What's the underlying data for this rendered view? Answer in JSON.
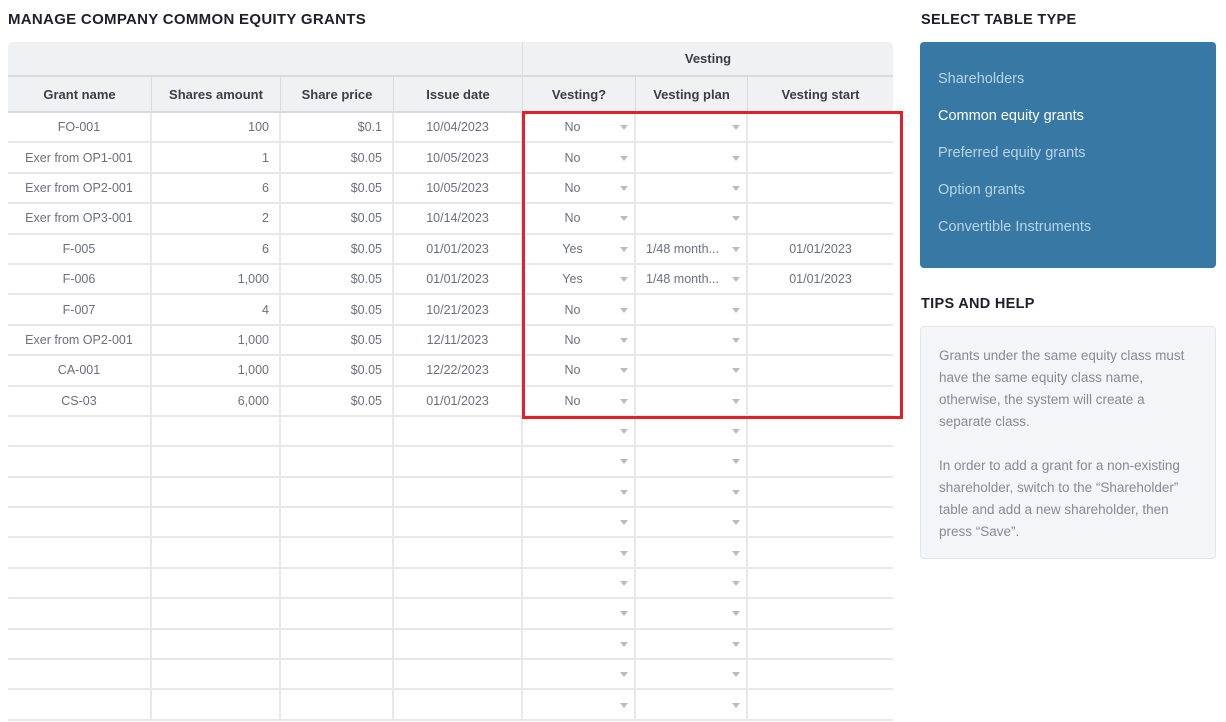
{
  "main": {
    "title": "MANAGE COMPANY COMMON EQUITY GRANTS",
    "group_header": "Vesting",
    "columns": [
      "Grant name",
      "Shares amount",
      "Share price",
      "Issue date",
      "Vesting?",
      "Vesting plan",
      "Vesting start"
    ],
    "rows": [
      {
        "grant_name": "FO-001",
        "shares": "100",
        "price": "$0.1",
        "issue_date": "10/04/2023",
        "vesting": "No",
        "plan": "",
        "start": ""
      },
      {
        "grant_name": "Exer from OP1-001",
        "shares": "1",
        "price": "$0.05",
        "issue_date": "10/05/2023",
        "vesting": "No",
        "plan": "",
        "start": ""
      },
      {
        "grant_name": "Exer from OP2-001",
        "shares": "6",
        "price": "$0.05",
        "issue_date": "10/05/2023",
        "vesting": "No",
        "plan": "",
        "start": ""
      },
      {
        "grant_name": "Exer from OP3-001",
        "shares": "2",
        "price": "$0.05",
        "issue_date": "10/14/2023",
        "vesting": "No",
        "plan": "",
        "start": ""
      },
      {
        "grant_name": "F-005",
        "shares": "6",
        "price": "$0.05",
        "issue_date": "01/01/2023",
        "vesting": "Yes",
        "plan": "1/48 month...",
        "start": "01/01/2023"
      },
      {
        "grant_name": "F-006",
        "shares": "1,000",
        "price": "$0.05",
        "issue_date": "01/01/2023",
        "vesting": "Yes",
        "plan": "1/48 month...",
        "start": "01/01/2023"
      },
      {
        "grant_name": "F-007",
        "shares": "4",
        "price": "$0.05",
        "issue_date": "10/21/2023",
        "vesting": "No",
        "plan": "",
        "start": ""
      },
      {
        "grant_name": "Exer from OP2-001",
        "shares": "1,000",
        "price": "$0.05",
        "issue_date": "12/11/2023",
        "vesting": "No",
        "plan": "",
        "start": ""
      },
      {
        "grant_name": "CA-001",
        "shares": "1,000",
        "price": "$0.05",
        "issue_date": "12/22/2023",
        "vesting": "No",
        "plan": "",
        "start": ""
      },
      {
        "grant_name": "CS-03",
        "shares": "6,000",
        "price": "$0.05",
        "issue_date": "01/01/2023",
        "vesting": "No",
        "plan": "",
        "start": ""
      },
      {
        "grant_name": "",
        "shares": "",
        "price": "",
        "issue_date": "",
        "vesting": "",
        "plan": "",
        "start": ""
      },
      {
        "grant_name": "",
        "shares": "",
        "price": "",
        "issue_date": "",
        "vesting": "",
        "plan": "",
        "start": ""
      },
      {
        "grant_name": "",
        "shares": "",
        "price": "",
        "issue_date": "",
        "vesting": "",
        "plan": "",
        "start": ""
      },
      {
        "grant_name": "",
        "shares": "",
        "price": "",
        "issue_date": "",
        "vesting": "",
        "plan": "",
        "start": ""
      },
      {
        "grant_name": "",
        "shares": "",
        "price": "",
        "issue_date": "",
        "vesting": "",
        "plan": "",
        "start": ""
      },
      {
        "grant_name": "",
        "shares": "",
        "price": "",
        "issue_date": "",
        "vesting": "",
        "plan": "",
        "start": ""
      },
      {
        "grant_name": "",
        "shares": "",
        "price": "",
        "issue_date": "",
        "vesting": "",
        "plan": "",
        "start": ""
      },
      {
        "grant_name": "",
        "shares": "",
        "price": "",
        "issue_date": "",
        "vesting": "",
        "plan": "",
        "start": ""
      },
      {
        "grant_name": "",
        "shares": "",
        "price": "",
        "issue_date": "",
        "vesting": "",
        "plan": "",
        "start": ""
      },
      {
        "grant_name": "",
        "shares": "",
        "price": "",
        "issue_date": "",
        "vesting": "",
        "plan": "",
        "start": ""
      }
    ]
  },
  "sidebar": {
    "select_title": "SELECT TABLE TYPE",
    "table_types": [
      {
        "label": "Shareholders",
        "active": false
      },
      {
        "label": "Common equity grants",
        "active": true
      },
      {
        "label": "Preferred equity grants",
        "active": false
      },
      {
        "label": "Option grants",
        "active": false
      },
      {
        "label": "Convertible Instruments",
        "active": false
      }
    ],
    "tips_title": "TIPS AND HELP",
    "tips": [
      "Grants under the same equity class must have the same equity class name, otherwise, the system will create a separate class.",
      "In order to add a grant for a non-existing shareholder, switch to the “Shareholder” table and add a new shareholder, then press “Save”."
    ]
  },
  "colors": {
    "accent_panel": "#3779a4",
    "highlight_border": "#e0202a"
  }
}
